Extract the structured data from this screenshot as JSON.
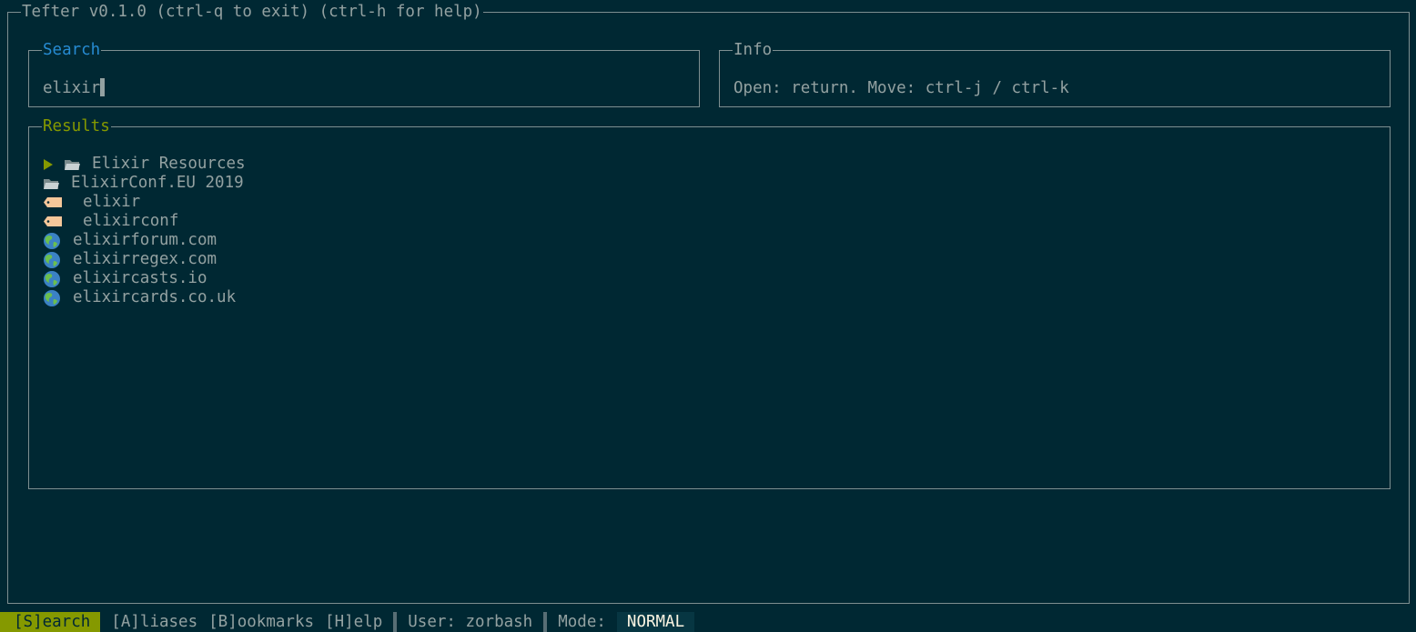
{
  "app": {
    "title": "Tefter v0.1.0 (ctrl-q to exit) (ctrl-h for help)"
  },
  "search": {
    "title": "Search",
    "value": "elixir"
  },
  "info": {
    "title": "Info",
    "text": "Open: return. Move: ctrl-j / ctrl-k"
  },
  "results": {
    "title": "Results",
    "items": [
      {
        "label": "Elixir Resources",
        "icon": "folder-icon",
        "selected": true
      },
      {
        "label": "ElixirConf.EU 2019",
        "icon": "folder-icon"
      },
      {
        "label": "elixir",
        "icon": "tag-icon"
      },
      {
        "label": "elixirconf",
        "icon": "tag-icon"
      },
      {
        "label": "elixirforum.com",
        "icon": "globe-icon"
      },
      {
        "label": "elixirregex.com",
        "icon": "globe-icon"
      },
      {
        "label": "elixircasts.io",
        "icon": "globe-icon"
      },
      {
        "label": "elixircards.co.uk",
        "icon": "globe-icon"
      }
    ]
  },
  "statusbar": {
    "tabs": [
      "[S]earch",
      "[A]liases",
      "[B]ookmarks",
      "[H]elp"
    ],
    "user": "User: zorbash",
    "mode_label": "Mode:",
    "mode_value": "NORMAL"
  },
  "colors": {
    "background": "#002833",
    "border": "#7e8f91",
    "search_title": "#268bd2",
    "results_title": "#859900",
    "active_tab": "#859900"
  }
}
